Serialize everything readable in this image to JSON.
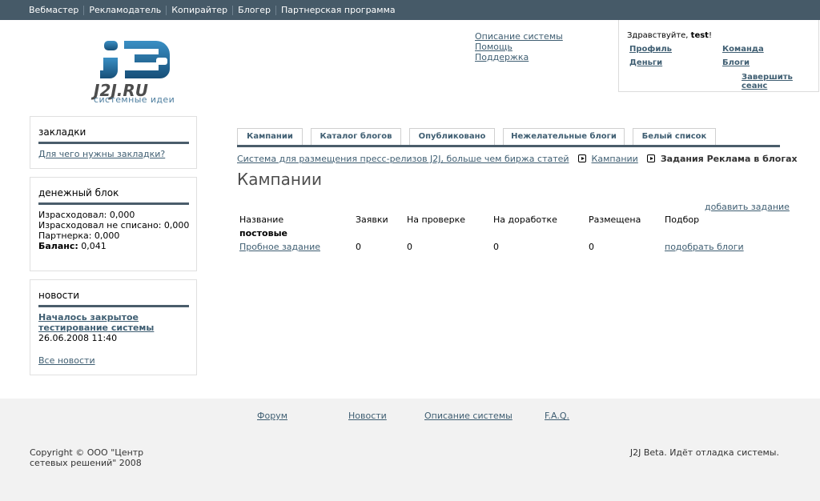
{
  "topnav": {
    "items": [
      "Вебмастер",
      "Рекламодатель",
      "Копирайтер",
      "Блогер",
      "Партнерская программа"
    ]
  },
  "logo": {
    "name": "J2J.RU",
    "tagline": "системные идеи"
  },
  "helplinks": [
    "Описание системы",
    "Помощь",
    "Поддержка"
  ],
  "user": {
    "greeting": "Здравствуйте, ",
    "username": "test",
    "greeting_end": "!",
    "profile": "Профиль",
    "team": "Команда",
    "money": "Деньги",
    "blogs": "Блоги",
    "logout": "Завершить сеанс"
  },
  "sidebar": {
    "bookmarks": {
      "title": "закладки",
      "link": "Для чего нужны закладки?"
    },
    "money": {
      "title": "денежный блок",
      "spent": "Израсходовал: 0,000",
      "spent_unwritten": "Израсходовал не списано: 0,000",
      "partner": "Партнерка: 0,000",
      "balance_label": "Баланс:",
      "balance_value": " 0,041"
    },
    "news": {
      "title": "новости",
      "headline_1": "Началось закрытое",
      "headline_2": "тестирование системы",
      "date": "26.06.2008 11:40",
      "all": "Все новости"
    }
  },
  "tabs": [
    "Кампании",
    "Каталог блогов",
    "Опубликовано",
    "Нежелательные блоги",
    "Белый список"
  ],
  "breadcrumbs": {
    "root": "Система для размещения пресс-релизов J2J, больше чем биржа статей",
    "campaigns": "Кампании",
    "current": "Задания Реклама в блогах"
  },
  "page": {
    "title": "Кампании",
    "add_task": "добавить задание"
  },
  "table": {
    "headers": [
      "Название",
      "Заявки",
      "На проверке",
      "На доработке",
      "Размещена",
      "Подбор"
    ],
    "group": "постовые",
    "row": {
      "name": "Пробное задание",
      "requests": "0",
      "review": "0",
      "rework": "0",
      "placed": "0",
      "select": "подобрать блоги"
    }
  },
  "footer": {
    "links": [
      "Форум",
      "Новости",
      "Описание системы",
      "F.A.Q."
    ],
    "copyright": "Copyright © ООО \"Центр сетевых решений\" 2008",
    "beta": "J2J Beta. Идёт отладка системы."
  },
  "colors": {
    "topnav": "#465a68",
    "accent_rule": "#4a5d6b",
    "link": "#3f5e72",
    "logo_blue": "#1f5f8b",
    "footer_bg": "#f2f2f2"
  }
}
